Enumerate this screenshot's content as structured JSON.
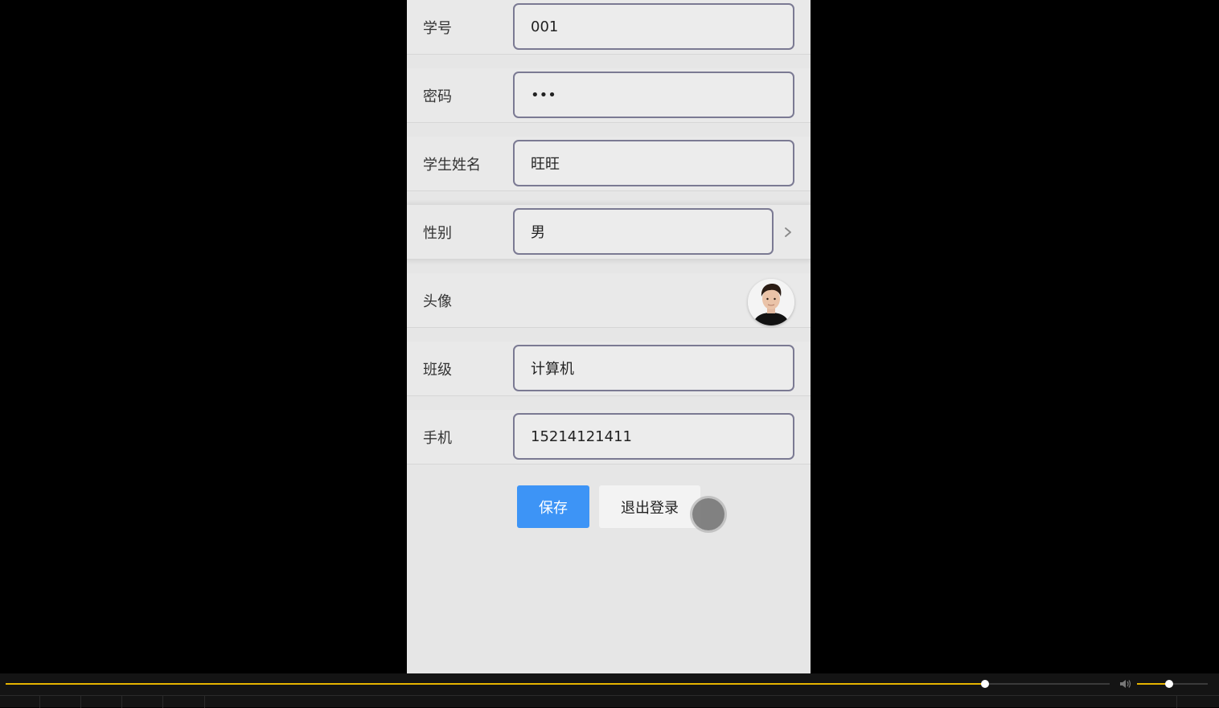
{
  "form": {
    "rows": [
      {
        "label": "学号",
        "value": "001"
      },
      {
        "label": "密码",
        "value": "•••"
      },
      {
        "label": "学生姓名",
        "value": "旺旺"
      },
      {
        "label": "性别",
        "value": "男"
      },
      {
        "label": "头像"
      },
      {
        "label": "班级",
        "value": "计算机"
      },
      {
        "label": "手机",
        "value": "15214121411"
      }
    ]
  },
  "actions": {
    "save_label": "保存",
    "logout_label": "退出登录"
  },
  "player": {
    "progress_fraction": 0.887,
    "volume_fraction": 0.45,
    "volume_icon": "speaker-icon"
  },
  "colors": {
    "primary": "#3d94f6",
    "progress": "#e6b400",
    "page_bg": "#e6e6e6"
  }
}
